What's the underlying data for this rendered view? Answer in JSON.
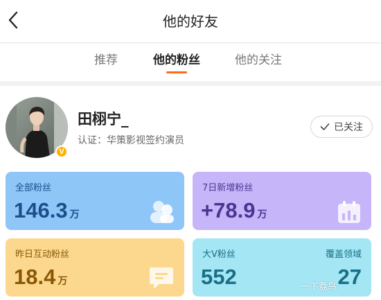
{
  "header": {
    "title": "他的好友",
    "back_icon": "chevron-left-icon"
  },
  "tabs": [
    {
      "label": "推荐",
      "active": false
    },
    {
      "label": "他的粉丝",
      "active": true
    },
    {
      "label": "他的关注",
      "active": false
    }
  ],
  "accent_color": "#ff6a1a",
  "profile": {
    "name": "田栩宁_",
    "certification": "认证：华策影视签约演员",
    "verified_badge_icon": "verified-v-icon",
    "verified_badge_text": "V",
    "follow_button": {
      "icon": "check-icon",
      "label": "已关注"
    }
  },
  "stats": {
    "total_fans": {
      "label": "全部粉丝",
      "value": "146.3",
      "unit": "万",
      "icon": "people-icon",
      "color": "#8fc6f8"
    },
    "new_fans_7d": {
      "label": "7日新增粉丝",
      "value": "+78.9",
      "unit": "万",
      "icon": "calendar-icon",
      "color": "#c6b5f9"
    },
    "interactive_fans_yesterday": {
      "label": "昨日互动粉丝",
      "value": "18.4",
      "unit": "万",
      "icon": "chat-icon",
      "color": "#fcd88e"
    },
    "big_v_fans": {
      "label": "大V粉丝",
      "value": "552",
      "coverage_label": "覆盖领域",
      "coverage_value": "27",
      "color": "#a4e6f4"
    }
  },
  "watermark": "一下荔鸟"
}
